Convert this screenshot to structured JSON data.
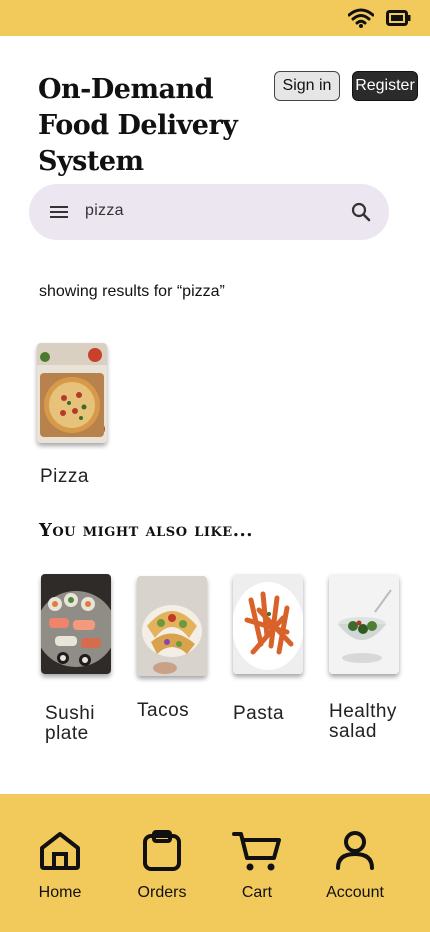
{
  "status_bar": {
    "icons": [
      "wifi-icon",
      "battery-icon"
    ]
  },
  "header": {
    "title": "On-Demand Food Delivery System",
    "signin_label": "Sign in",
    "register_label": "Register"
  },
  "search": {
    "value": "pizza",
    "icons": [
      "menu-icon",
      "search-icon"
    ]
  },
  "results": {
    "label": "showing results for “pizza”",
    "items": [
      {
        "label": "Pizza"
      }
    ]
  },
  "suggestions": {
    "title": "You might also like...",
    "items": [
      {
        "label": "Sushi plate"
      },
      {
        "label": "Tacos"
      },
      {
        "label": "Pasta"
      },
      {
        "label": "Healthy salad"
      }
    ]
  },
  "nav": {
    "items": [
      {
        "label": "Home",
        "icon": "home-icon"
      },
      {
        "label": "Orders",
        "icon": "clipboard-icon"
      },
      {
        "label": "Cart",
        "icon": "cart-icon"
      },
      {
        "label": "Account",
        "icon": "user-icon"
      }
    ]
  },
  "colors": {
    "accent": "#f2c95b",
    "search_bg": "#ece6f0",
    "register_bg": "#2b2b2b"
  }
}
